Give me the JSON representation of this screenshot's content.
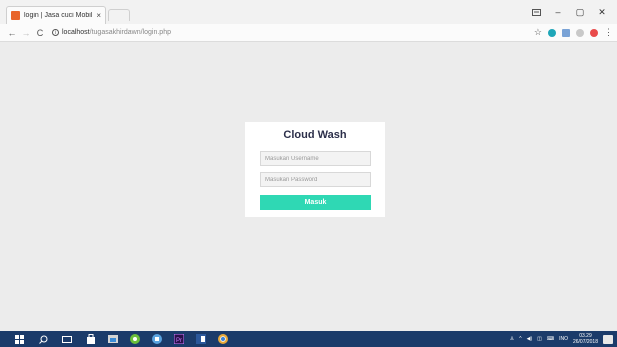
{
  "browser": {
    "tab_title": "login | Jasa cuci Mobil di",
    "tab_close": "×",
    "url_host": "localhost",
    "url_path": "/tugasakhirdawn/login.php",
    "window_controls": {
      "minimize": "–",
      "maximize": "▢",
      "close": "✕"
    }
  },
  "login": {
    "title": "Cloud Wash",
    "username_placeholder": "Masukan Username",
    "password_placeholder": "Masukan Password",
    "submit_label": "Masuk"
  },
  "taskbar": {
    "language": "INO",
    "time": "03.29",
    "date": "26/07/2018"
  },
  "colors": {
    "accent": "#2fd8b4",
    "title_text": "#2c2f4a",
    "taskbar": "#1b3b6a",
    "page_bg": "#ececec"
  }
}
